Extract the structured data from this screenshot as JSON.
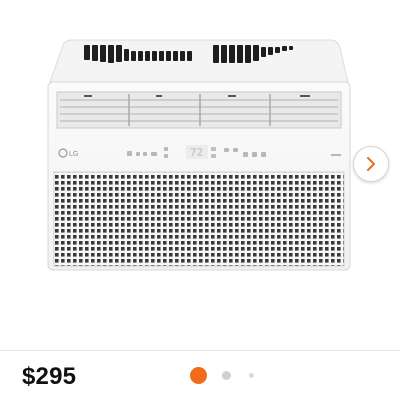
{
  "product": {
    "price": "$295",
    "brand_logo_text": "LG",
    "display_text": "72"
  },
  "carousel": {
    "total_images": 3,
    "current_index": 1,
    "next_icon": "chevron-right-icon"
  },
  "colors": {
    "accent": "#f26a1b",
    "dot_inactive": "#cfcfcf",
    "dot_small": "#d9d9d9",
    "chevron": "#f26a1b"
  }
}
